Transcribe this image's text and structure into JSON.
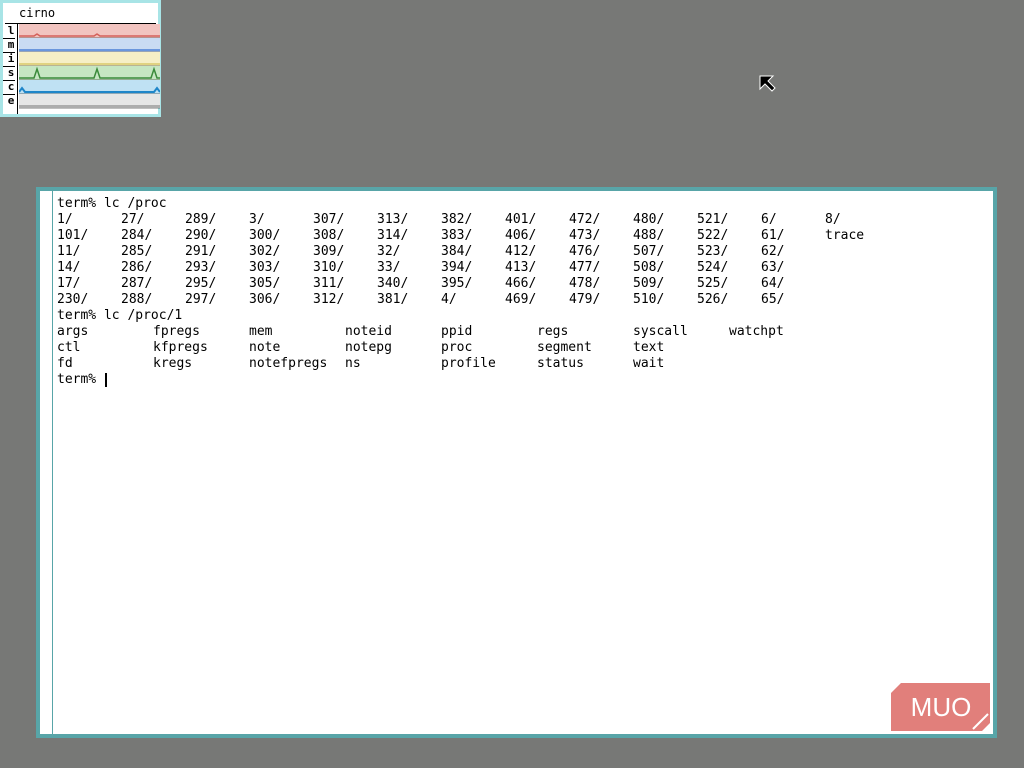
{
  "stats": {
    "host": "cirno",
    "rows": [
      {
        "label": "l",
        "color": "#d4605a",
        "fill": "#f2c4c0"
      },
      {
        "label": "m",
        "color": "#4b7fd6",
        "fill": "#c9dbf3"
      },
      {
        "label": "i",
        "color": "#d9c86a",
        "fill": "#f6efc6"
      },
      {
        "label": "s",
        "color": "#3a8a3a",
        "fill": "#c6e6c2"
      },
      {
        "label": "c",
        "color": "#1f86c9",
        "fill": "#bfe1f3"
      },
      {
        "label": "e",
        "color": "#9a9a9a",
        "fill": "#e6e6e6"
      }
    ]
  },
  "terminal": {
    "lines": [
      {
        "prompt": "term% lc /proc"
      },
      {
        "cells": [
          "1/",
          "27/",
          "289/",
          "3/",
          "307/",
          "313/",
          "382/",
          "401/",
          "472/",
          "480/",
          "521/",
          "6/",
          "8/"
        ]
      },
      {
        "cells": [
          "101/",
          "284/",
          "290/",
          "300/",
          "308/",
          "314/",
          "383/",
          "406/",
          "473/",
          "488/",
          "522/",
          "61/",
          "trace"
        ]
      },
      {
        "cells": [
          "11/",
          "285/",
          "291/",
          "302/",
          "309/",
          "32/",
          "384/",
          "412/",
          "476/",
          "507/",
          "523/",
          "62/"
        ]
      },
      {
        "cells": [
          "14/",
          "286/",
          "293/",
          "303/",
          "310/",
          "33/",
          "394/",
          "413/",
          "477/",
          "508/",
          "524/",
          "63/"
        ]
      },
      {
        "cells": [
          "17/",
          "287/",
          "295/",
          "305/",
          "311/",
          "340/",
          "395/",
          "466/",
          "478/",
          "509/",
          "525/",
          "64/"
        ]
      },
      {
        "cells": [
          "230/",
          "288/",
          "297/",
          "306/",
          "312/",
          "381/",
          "4/",
          "469/",
          "479/",
          "510/",
          "526/",
          "65/"
        ]
      },
      {
        "prompt": "term% lc /proc/1"
      },
      {
        "wide": [
          "args",
          "fpregs",
          "mem",
          "noteid",
          "ppid",
          "regs",
          "syscall",
          "watchpt"
        ]
      },
      {
        "wide": [
          "ctl",
          "kfpregs",
          "note",
          "notepg",
          "proc",
          "segment",
          "text"
        ]
      },
      {
        "wide": [
          "fd",
          "kregs",
          "notefpregs",
          "ns",
          "profile",
          "status",
          "wait"
        ]
      },
      {
        "prompt": "term% "
      }
    ]
  },
  "watermark": {
    "text": "MUO",
    "color": "#e17f7b"
  },
  "pointer": {
    "icon": "arrow-pointer-icon"
  }
}
